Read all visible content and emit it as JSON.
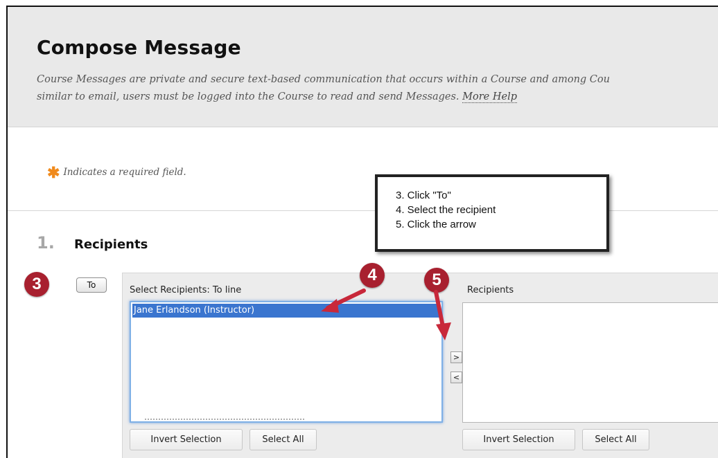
{
  "header": {
    "title": "Compose Message",
    "description_line1": "Course Messages are private and secure text-based communication that occurs within a Course and among Cou",
    "description_line2": "similar to email, users must be logged into the Course to read and send Messages.",
    "more_help": "More Help"
  },
  "required_note": {
    "asterisk": "✱",
    "text": "Indicates a required field."
  },
  "section": {
    "number": "1.",
    "title": "Recipients"
  },
  "to_button": "To",
  "select_panel": {
    "label": "Select Recipients: To line",
    "items": [
      "Jane Erlandson (Instructor)"
    ],
    "invert_label": "Invert Selection",
    "select_all_label": "Select All"
  },
  "recipients_panel": {
    "label": "Recipients",
    "invert_label": "Invert Selection",
    "select_all_label": "Select All"
  },
  "move_buttons": {
    "add": ">",
    "remove": "<"
  },
  "callout": {
    "lines": [
      "3. Click \"To\"",
      "4. Select the recipient",
      "5. Click the arrow"
    ]
  },
  "badges": [
    "3",
    "4",
    "5"
  ],
  "colors": {
    "badge": "#a8202f",
    "selection": "#3a75cf",
    "asterisk": "#f08a1c",
    "arrow": "#c8283a"
  }
}
